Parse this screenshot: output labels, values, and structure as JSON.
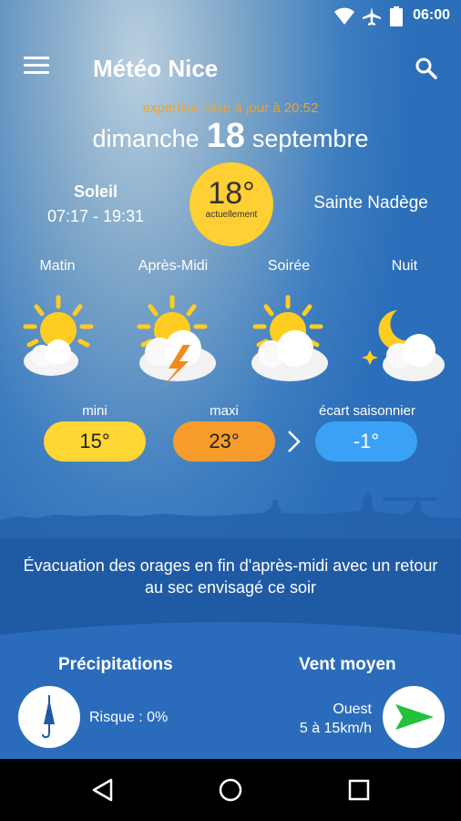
{
  "status_bar": {
    "time": "06:00",
    "icons": [
      "wifi-icon",
      "airplane-icon",
      "battery-icon"
    ]
  },
  "app_bar": {
    "title": "Météo Nice",
    "menu_icon": "menu-icon",
    "search_icon": "search-icon"
  },
  "header": {
    "update_text": "expertise mise à jour à 20:52",
    "weekday": "dimanche",
    "day_number": "18",
    "month": "septembre"
  },
  "sun": {
    "title": "Soleil",
    "hours": "07:17 - 19:31"
  },
  "current": {
    "temperature": "18°",
    "label": "actuellement"
  },
  "saint": "Sainte Nadège",
  "periods": [
    {
      "label": "Matin",
      "icon": "sun-cloud-icon"
    },
    {
      "label": "Après-Midi",
      "icon": "thunderstorm-icon"
    },
    {
      "label": "Soirée",
      "icon": "sun-cloud-icon"
    },
    {
      "label": "Nuit",
      "icon": "moon-cloud-icon"
    }
  ],
  "temps": {
    "min_label": "mini",
    "min_value": "15°",
    "max_label": "maxi",
    "max_value": "23°",
    "gap_label": "écart saisonnier",
    "gap_value": "-1°"
  },
  "forecast_text": "Évacuation des orages en fin d'après-midi avec un retour au sec envisagé ce soir",
  "precipitation": {
    "title": "Précipitations",
    "risk": "Risque : 0%",
    "icon": "umbrella-icon"
  },
  "wind": {
    "title": "Vent moyen",
    "direction": "Ouest",
    "speed": "5 à 15km/h",
    "icon": "wind-arrow-icon"
  },
  "colors": {
    "sun_yellow": "#ffcf33",
    "min_pill": "#ffd633",
    "max_pill": "#f79c2a",
    "gap_pill": "#3aa2f5",
    "update_orange": "#f0a22e",
    "lower_blue": "#1f5aa5"
  },
  "nav": {
    "back_icon": "back-icon",
    "home_icon": "home-icon",
    "recents_icon": "recents-icon"
  }
}
